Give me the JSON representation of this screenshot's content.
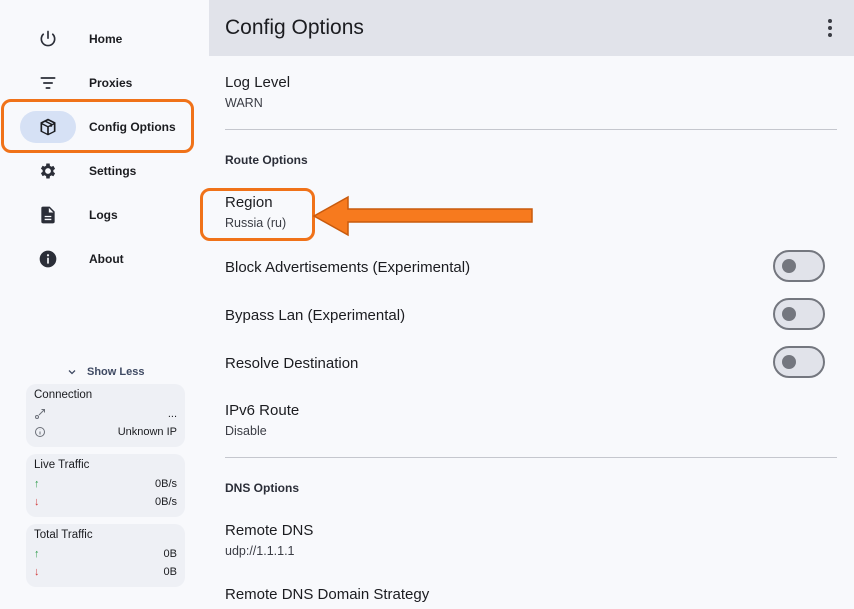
{
  "sidebar": {
    "items": [
      {
        "label": "Home",
        "icon": "power-icon"
      },
      {
        "label": "Proxies",
        "icon": "filter-list-icon"
      },
      {
        "label": "Config Options",
        "icon": "box-icon"
      },
      {
        "label": "Settings",
        "icon": "gear-icon"
      },
      {
        "label": "Logs",
        "icon": "document-icon"
      },
      {
        "label": "About",
        "icon": "info-icon"
      }
    ],
    "active_item": "Config Options",
    "show_less_label": "Show Less",
    "connection_card": {
      "title": "Connection",
      "value1": "...",
      "value2": "Unknown IP"
    },
    "live_traffic_card": {
      "title": "Live Traffic",
      "up": "0B/s",
      "down": "0B/s"
    },
    "total_traffic_card": {
      "title": "Total Traffic",
      "up": "0B",
      "down": "0B"
    }
  },
  "header": {
    "title": "Config Options"
  },
  "main": {
    "log_level": {
      "title": "Log Level",
      "value": "WARN"
    },
    "route_options": {
      "header": "Route Options",
      "region": {
        "title": "Region",
        "value": "Russia (ru)"
      },
      "block_ads": {
        "title": "Block Advertisements (Experimental)",
        "enabled": false
      },
      "bypass_lan": {
        "title": "Bypass Lan (Experimental)",
        "enabled": false
      },
      "resolve_destination": {
        "title": "Resolve Destination",
        "enabled": false
      },
      "ipv6_route": {
        "title": "IPv6 Route",
        "value": "Disable"
      }
    },
    "dns_options": {
      "header": "DNS Options",
      "remote_dns": {
        "title": "Remote DNS",
        "value": "udp://1.1.1.1"
      },
      "remote_dns_domain_strategy": {
        "title": "Remote DNS Domain Strategy"
      }
    }
  },
  "colors": {
    "annotation": "#f07219",
    "active_nav_bg": "#d6e1f5",
    "topbar_bg": "#e1e3ea"
  }
}
